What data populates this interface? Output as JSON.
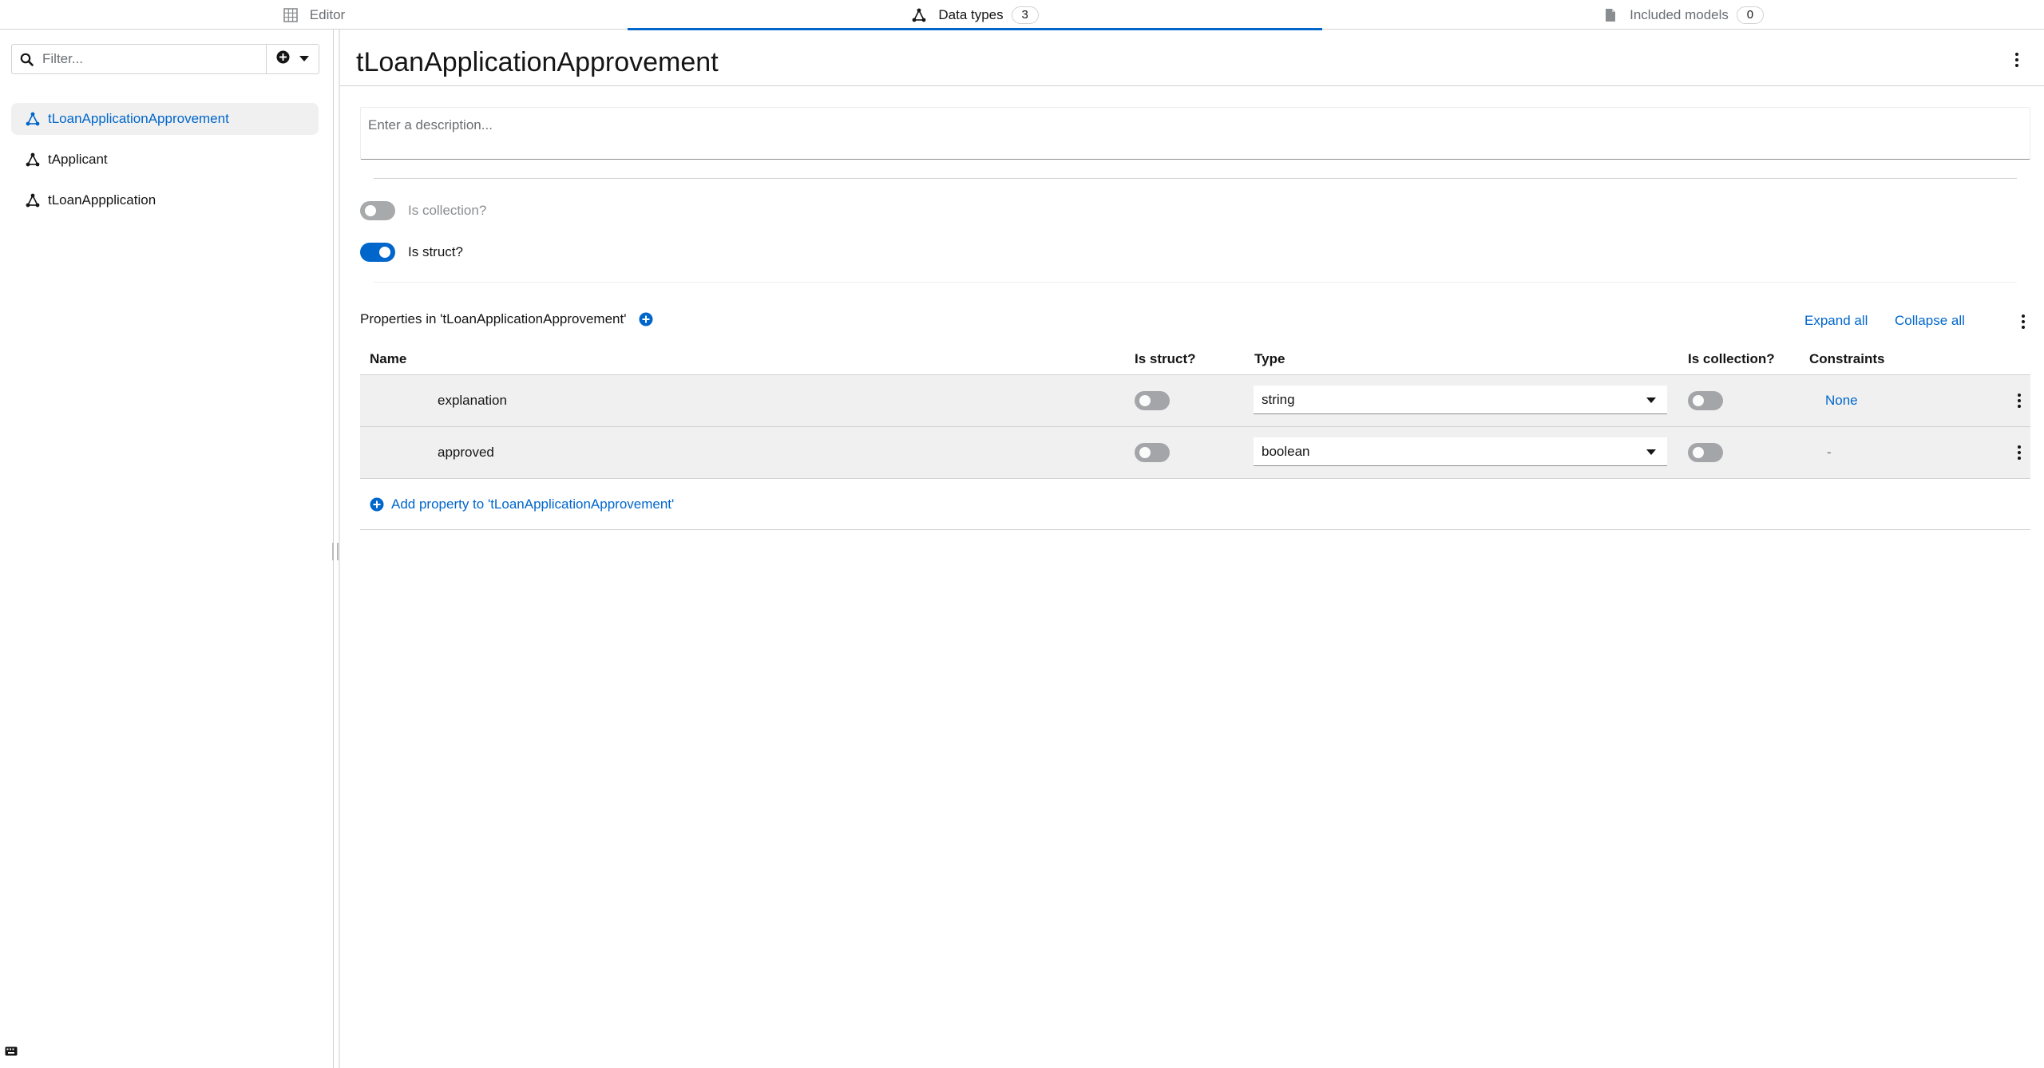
{
  "tabs": [
    {
      "label": "Editor",
      "icon": "grid-icon",
      "active": false
    },
    {
      "label": "Data types",
      "icon": "data-types-icon",
      "badge": "3",
      "active": true
    },
    {
      "label": "Included models",
      "icon": "document-icon",
      "badge": "0",
      "active": false
    }
  ],
  "sidebar": {
    "filter_placeholder": "Filter...",
    "items": [
      {
        "label": "tLoanApplicationApprovement",
        "selected": true
      },
      {
        "label": "tApplicant",
        "selected": false
      },
      {
        "label": "tLoanAppplication",
        "selected": false
      }
    ]
  },
  "main": {
    "title": "tLoanApplicationApprovement",
    "description_placeholder": "Enter a description...",
    "is_collection_label": "Is collection?",
    "is_collection": false,
    "is_struct_label": "Is struct?",
    "is_struct": true,
    "properties_heading": "Properties in 'tLoanApplicationApprovement'",
    "expand_all": "Expand all",
    "collapse_all": "Collapse all",
    "columns": {
      "name": "Name",
      "is_struct": "Is struct?",
      "type": "Type",
      "is_collection": "Is collection?",
      "constraints": "Constraints"
    },
    "rows": [
      {
        "name": "explanation",
        "is_struct": false,
        "type": "string",
        "is_collection": false,
        "constraints": "None"
      },
      {
        "name": "approved",
        "is_struct": false,
        "type": "boolean",
        "is_collection": false,
        "constraints": "-"
      }
    ],
    "add_property": "Add property to 'tLoanApplicationApprovement'"
  },
  "colors": {
    "accent": "#0066cc",
    "text": "#151515",
    "muted": "#6a6e73",
    "border": "#d2d2d2",
    "row_bg": "#f0f0f0"
  }
}
